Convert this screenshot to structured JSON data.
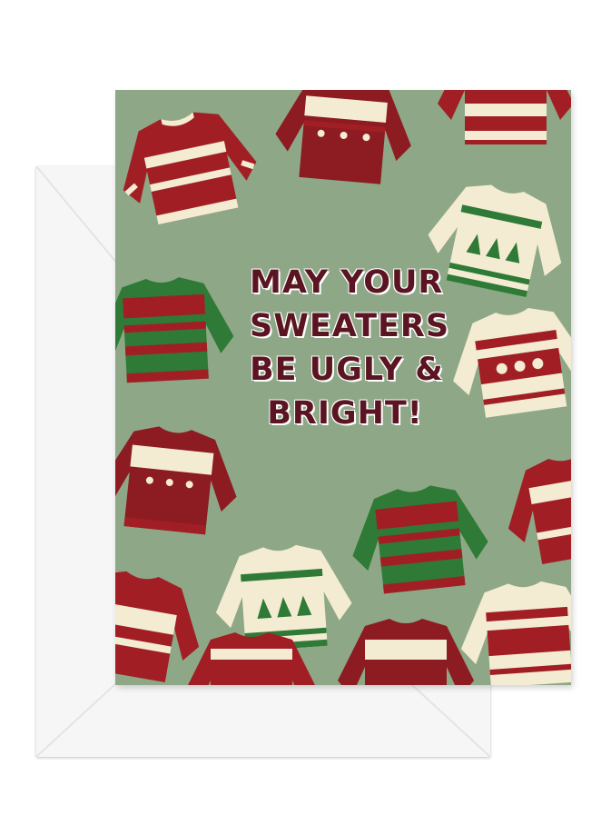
{
  "card": {
    "message_lines": [
      "MAY YOUR",
      "SWEATERS",
      "BE UGLY &",
      "BRIGHT!"
    ],
    "colors": {
      "background": "#8ea887",
      "text": "#5b1522",
      "sweater_red": "#a11f24",
      "sweater_dark_red": "#7f1a22",
      "sweater_green": "#2f7a36",
      "sweater_cream": "#f4ecd2"
    }
  },
  "envelope": {
    "color": "#f6f6f6"
  }
}
